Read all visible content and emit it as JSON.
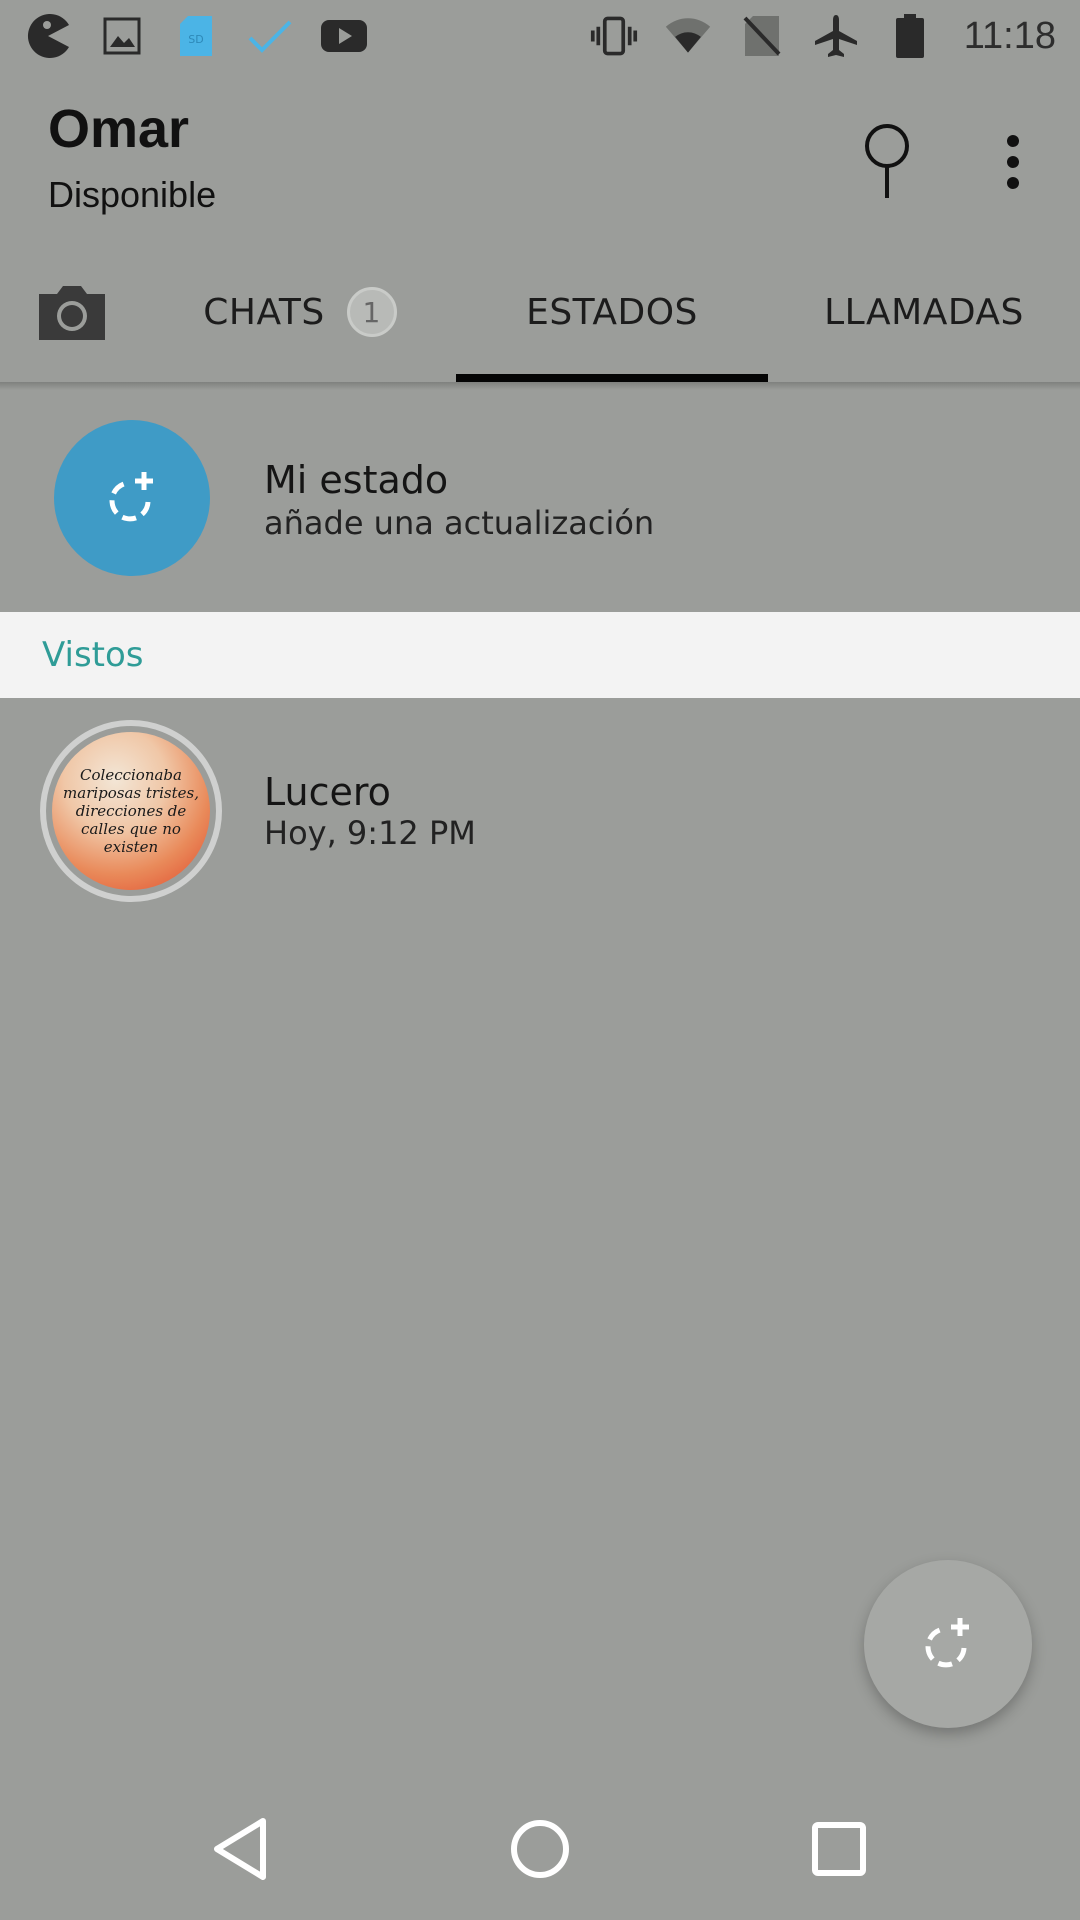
{
  "status_bar": {
    "time": "11:18",
    "left_icons": [
      "pacman-icon",
      "image-icon",
      "sd-card-icon",
      "check-icon",
      "youtube-icon"
    ],
    "right_icons": [
      "vibrate-icon",
      "wifi-icon",
      "no-sim-icon",
      "airplane-icon",
      "battery-icon"
    ]
  },
  "app_bar": {
    "title": "Omar",
    "subtitle": "Disponible",
    "actions": [
      "search-icon",
      "more-vert-icon"
    ]
  },
  "tabs": {
    "camera_icon": "camera-icon",
    "chats": {
      "label": "CHATS",
      "badge": "1"
    },
    "estados": {
      "label": "ESTADOS",
      "selected": true
    },
    "llamadas": {
      "label": "LLAMADAS"
    }
  },
  "my_status": {
    "title": "Mi estado",
    "subtitle": "añade una actualización",
    "avatar_color": "#3f9bc6"
  },
  "section": {
    "label": "Vistos",
    "color": "#2f9c97"
  },
  "contacts": [
    {
      "name": "Lucero",
      "time": "Hoy, 9:12 PM",
      "thumbnail_text": "Coleccionaba mariposas tristes, direcciones de calles que no existen"
    }
  ],
  "colors": {
    "background": "#9b9d9a",
    "tab_indicator": "#050505"
  },
  "nav_bar": [
    "back-icon",
    "home-icon",
    "recents-icon"
  ]
}
